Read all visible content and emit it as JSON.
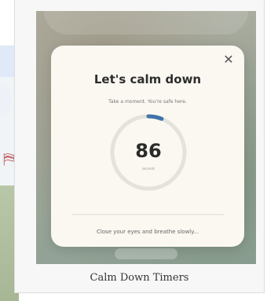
{
  "modal": {
    "title": "Let's calm down",
    "subtitle": "Take a moment. You're safe here.",
    "timer_value": "86",
    "timer_unit": "seconds",
    "footer": "Close your eyes and breathe slowly...",
    "close_icon": "close-icon"
  },
  "timer": {
    "progress_fraction": 0.06,
    "track_color": "#e5e2dc",
    "progress_color": "#3f74a8"
  },
  "figure": {
    "caption": "Calm Down Timers"
  }
}
